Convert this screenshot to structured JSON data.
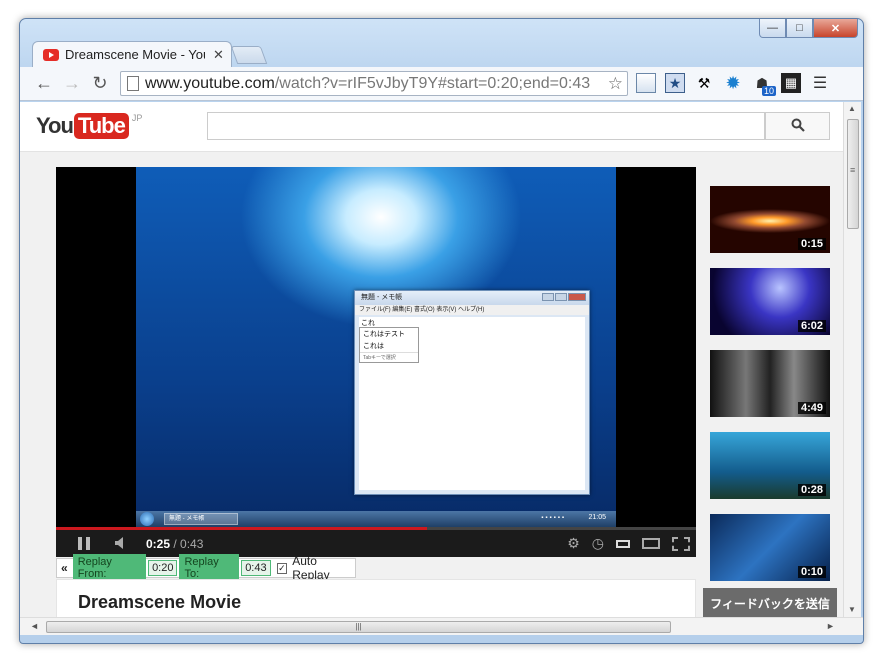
{
  "window": {
    "min_label": "—",
    "max_label": "□",
    "close_label": "✕"
  },
  "tab": {
    "title": "Dreamscene Movie - YouTube",
    "close": "✕"
  },
  "nav": {
    "back": "←",
    "forward": "→",
    "reload": "↻"
  },
  "omnibox": {
    "host": "www.youtube.com",
    "path": "/watch?v=rIF5vJbyT9Y#start=0:20;end=0:43",
    "star": "☆"
  },
  "extensions": {
    "tenth_badge": "10",
    "menu": "☰"
  },
  "youtube": {
    "logo_you": "You",
    "logo_tube": "Tube",
    "logo_region": "JP",
    "search_placeholder": "",
    "search_icon": "⚲"
  },
  "video_content": {
    "notepad_title": "無題 - メモ帳",
    "notepad_menu": "ファイル(F)  編集(E)  書式(O)  表示(V)  ヘルプ(H)",
    "notepad_text": "これ",
    "suggestions": [
      "これはテスト",
      "これは"
    ],
    "suggest_hint": "Tabキーで選択",
    "taskbar_item": "無題 - メモ帳",
    "clock": "21:05"
  },
  "player": {
    "current_time": "0:25",
    "separator": " / ",
    "duration": "0:43",
    "progress_fraction": 0.58,
    "settings_icon": "gear-icon",
    "watch_later_icon": "clock-icon"
  },
  "replay": {
    "collapse": "«",
    "from_label": "Replay From:",
    "from_value": "0:20",
    "to_label": "Replay To:",
    "to_value": "0:43",
    "auto_checked": "✓",
    "auto_label": "Auto Replay"
  },
  "video": {
    "title": "Dreamscene Movie"
  },
  "related": [
    {
      "duration": "0:15"
    },
    {
      "duration": "6:02"
    },
    {
      "duration": "4:49"
    },
    {
      "duration": "0:28"
    },
    {
      "duration": "0:10"
    }
  ],
  "feedback_label": "フィードバックを送信",
  "scrollbar": {
    "grip": "≡",
    "hgrip": "|||",
    "up": "▲",
    "down": "▼",
    "left": "◄",
    "right": "►"
  },
  "colors": {
    "youtube_red": "#d9281f",
    "progress_red": "#cc181e",
    "replay_green": "#4fb978"
  }
}
